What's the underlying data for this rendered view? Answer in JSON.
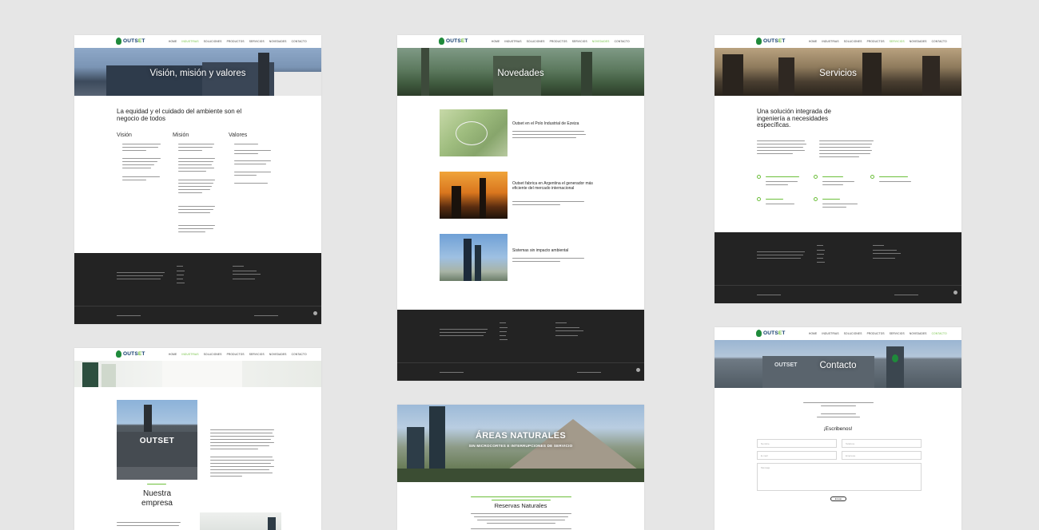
{
  "brand": {
    "name_a": "OUTS",
    "name_b": "E",
    "name_c": "T",
    "accent": "#6cbf3a",
    "navy": "#0f3a6b"
  },
  "menus": {
    "p1": [
      "Home",
      "Industrias",
      "Soluciones",
      "Productos",
      "Servicios",
      "Novedades",
      "Contacto"
    ],
    "p2": [
      "Home",
      "Industrias",
      "Soluciones",
      "Productos",
      "Servicios",
      "Novedades",
      "Contacto"
    ],
    "p3": [
      "Home",
      "Industrias",
      "Soluciones",
      "Productos",
      "Servicios",
      "Novedades",
      "Contacto"
    ],
    "p4": [
      "Home",
      "Industrias",
      "Soluciones",
      "Productos",
      "Servicios",
      "Novedades",
      "Contacto"
    ],
    "p6": [
      "Home",
      "Industrias",
      "Soluciones",
      "Productos",
      "Servicios",
      "Novedades",
      "Contacto"
    ]
  },
  "page1": {
    "hero_title": "Visión, misión y valores",
    "heading": "La equidad y el cuidado del ambiente son el negocio de todos",
    "col1": "Visión",
    "col2": "Misión",
    "col3": "Valores"
  },
  "page2": {
    "hero_title": "Novedades",
    "news": [
      "Outset en el Polo Industrial de Ezeiza",
      "Outset fabrica en Argentina el generador más eficiente del mercado internacional",
      "Sistemas sin impacto ambiental"
    ]
  },
  "page3": {
    "hero_title": "Servicios",
    "heading": "Una solución integrada de ingeniería a necesidades específicas."
  },
  "page4": {
    "heading_a": "Nuestra",
    "heading_b": "empresa",
    "hero_word": "OUTSET"
  },
  "page5": {
    "hero_title": "ÁREAS NATURALES",
    "hero_sub": "SIN MICROCORTES E INTERRUPCIONES DE SERVICIO",
    "section": "Reservas Naturales"
  },
  "page6": {
    "hero_title": "Contacto",
    "hero_word": "OUTSET",
    "cta": "¡Escribenos!",
    "fields": [
      "Nombre",
      "Teléfono",
      "E-mail",
      "Empresa",
      "Mensaje"
    ],
    "button": "Enviar"
  }
}
